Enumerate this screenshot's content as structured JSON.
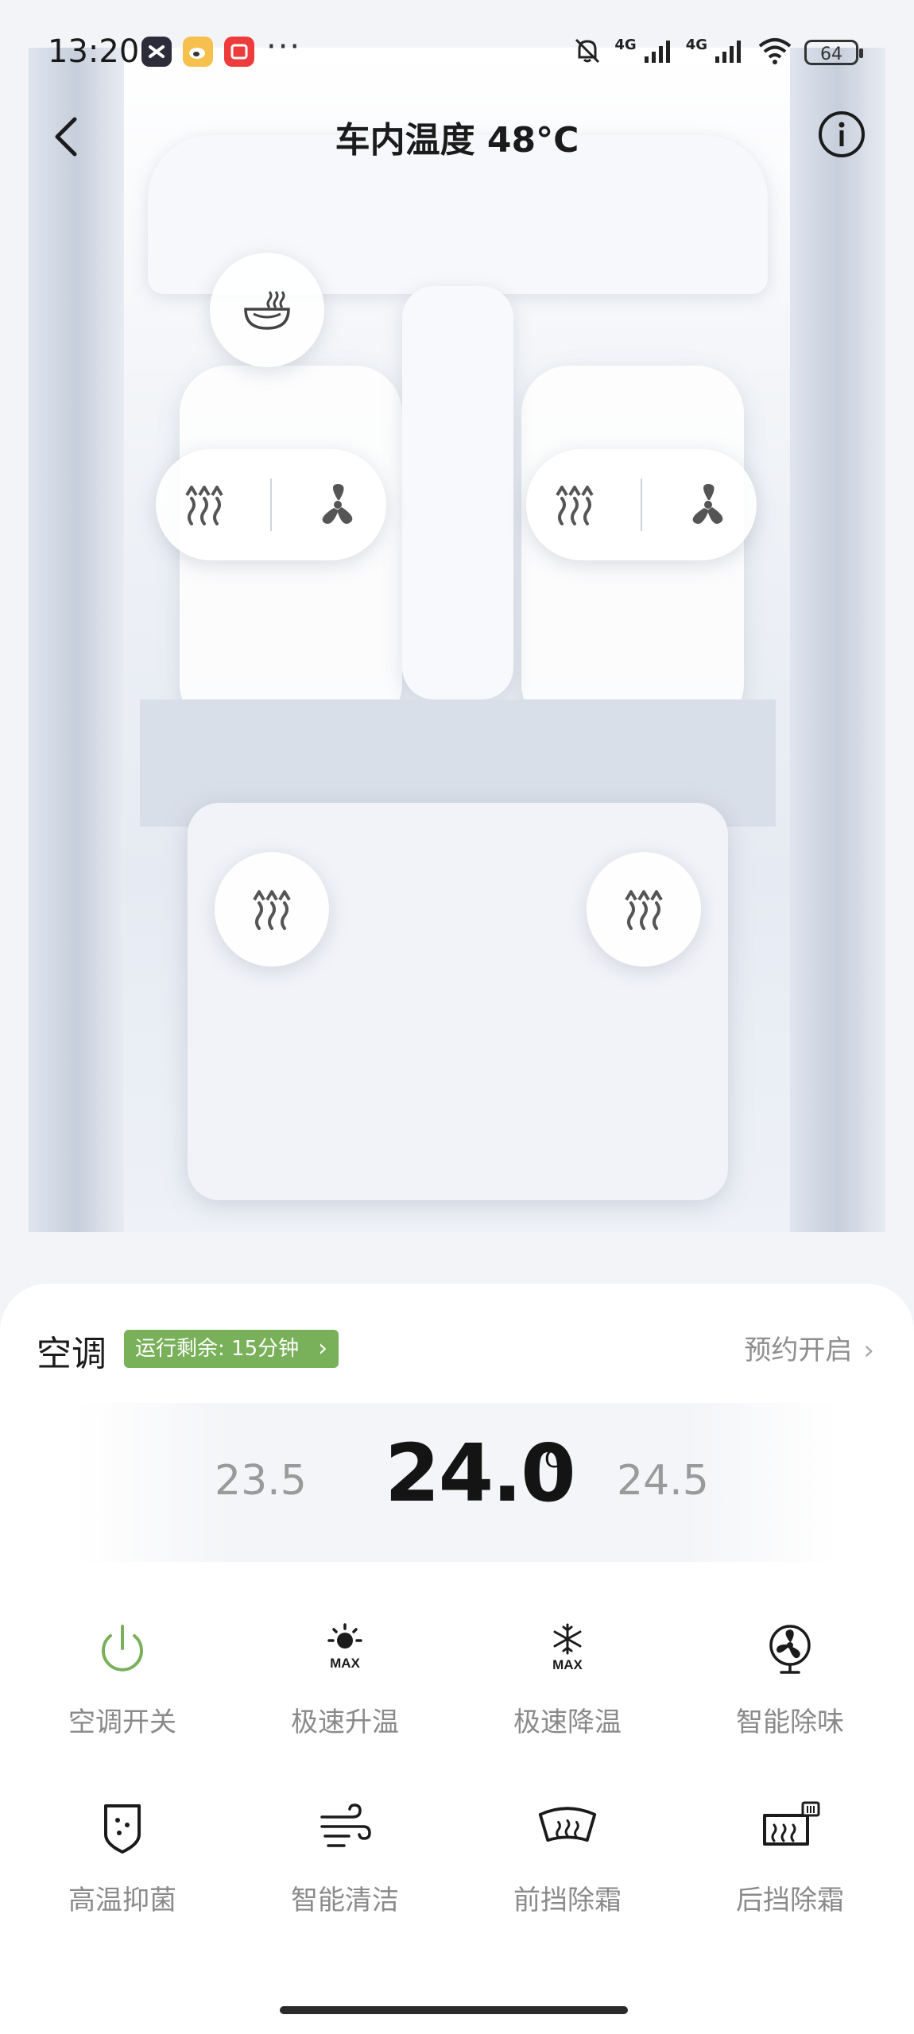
{
  "status_bar": {
    "time": "13:20",
    "app_icons": [
      "capcut-icon",
      "weibo-icon",
      "red-app-icon"
    ],
    "more": "···",
    "network_1": "4G",
    "network_2": "4G",
    "battery": "64"
  },
  "header": {
    "title": "车内温度 48°C"
  },
  "car": {
    "front_defrost_icon": "defrost-front-icon",
    "left_seat_controls": [
      "seat-heat-icon",
      "seat-vent-icon"
    ],
    "right_seat_controls": [
      "seat-heat-icon",
      "seat-vent-icon"
    ],
    "rear_left_icon": "seat-heat-icon",
    "rear_right_icon": "seat-heat-icon"
  },
  "ac": {
    "title": "空调",
    "badge": "运行剩余: 15分钟",
    "schedule": "预约开启",
    "temp_low": "23.5",
    "temp_current": "24.0",
    "temp_unit": "°C",
    "temp_high": "24.5",
    "accent_color": "#79b05a"
  },
  "functions": [
    {
      "label": "空调开关",
      "icon": "power-icon"
    },
    {
      "label": "极速升温",
      "icon": "sun-max-icon"
    },
    {
      "label": "极速降温",
      "icon": "snow-max-icon"
    },
    {
      "label": "智能除味",
      "icon": "fan-icon"
    },
    {
      "label": "高温抑菌",
      "icon": "shield-icon"
    },
    {
      "label": "智能清洁",
      "icon": "wind-icon"
    },
    {
      "label": "前挡除霜",
      "icon": "front-defrost-icon"
    },
    {
      "label": "后挡除霜",
      "icon": "rear-defrost-icon"
    }
  ]
}
